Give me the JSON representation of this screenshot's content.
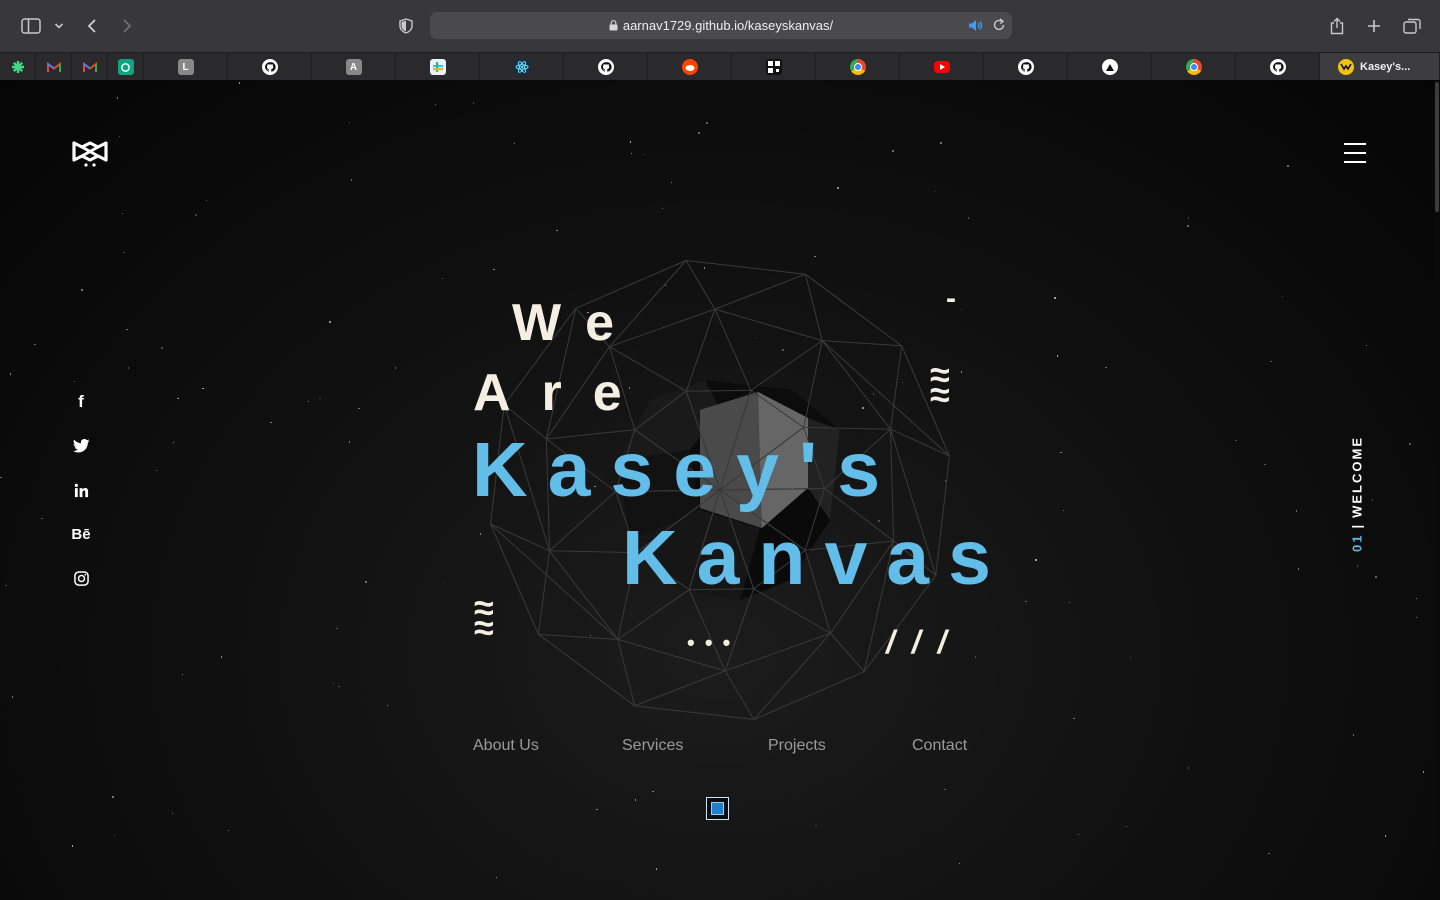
{
  "browser": {
    "url": "aarnav1729.github.io/kaseyskanvas/",
    "tabs": [
      {
        "icon": "pinwheel-icon",
        "letter": ""
      },
      {
        "icon": "gmail-icon",
        "letter": ""
      },
      {
        "icon": "gmail-icon",
        "letter": ""
      },
      {
        "icon": "chatgpt-icon",
        "letter": ""
      },
      {
        "icon": "letter-favicon",
        "letter": "L"
      },
      {
        "icon": "github-icon",
        "letter": ""
      },
      {
        "icon": "letter-favicon",
        "letter": "A"
      },
      {
        "icon": "slack-icon",
        "letter": ""
      },
      {
        "icon": "react-icon",
        "letter": ""
      },
      {
        "icon": "github-icon",
        "letter": ""
      },
      {
        "icon": "reddit-icon",
        "letter": ""
      },
      {
        "icon": "qr-icon",
        "letter": ""
      },
      {
        "icon": "chrome-icon",
        "letter": ""
      },
      {
        "icon": "youtube-icon",
        "letter": ""
      },
      {
        "icon": "github-icon",
        "letter": ""
      },
      {
        "icon": "vercel-icon",
        "letter": ""
      },
      {
        "icon": "chrome-icon",
        "letter": ""
      },
      {
        "icon": "github-icon",
        "letter": ""
      }
    ],
    "active_tab": {
      "title": "Kasey's...",
      "icon": "kaseys-kanvas-favicon"
    }
  },
  "site": {
    "hero": {
      "line1": "We",
      "line2": "Are",
      "line3": "Kasey's",
      "line4": "Kanvas"
    },
    "decorations": {
      "dash": "-",
      "wave": "≈",
      "dots": "• • •",
      "slashes": "/ / /"
    },
    "nav": [
      "About Us",
      "Services",
      "Projects",
      "Contact"
    ],
    "social": {
      "facebook": "f",
      "behance": "Bē"
    },
    "side_label": {
      "number": "01",
      "separator": "|",
      "word": "WELCOME"
    },
    "colors": {
      "accent": "#62bde9",
      "hero_text": "#f4efe2"
    }
  }
}
